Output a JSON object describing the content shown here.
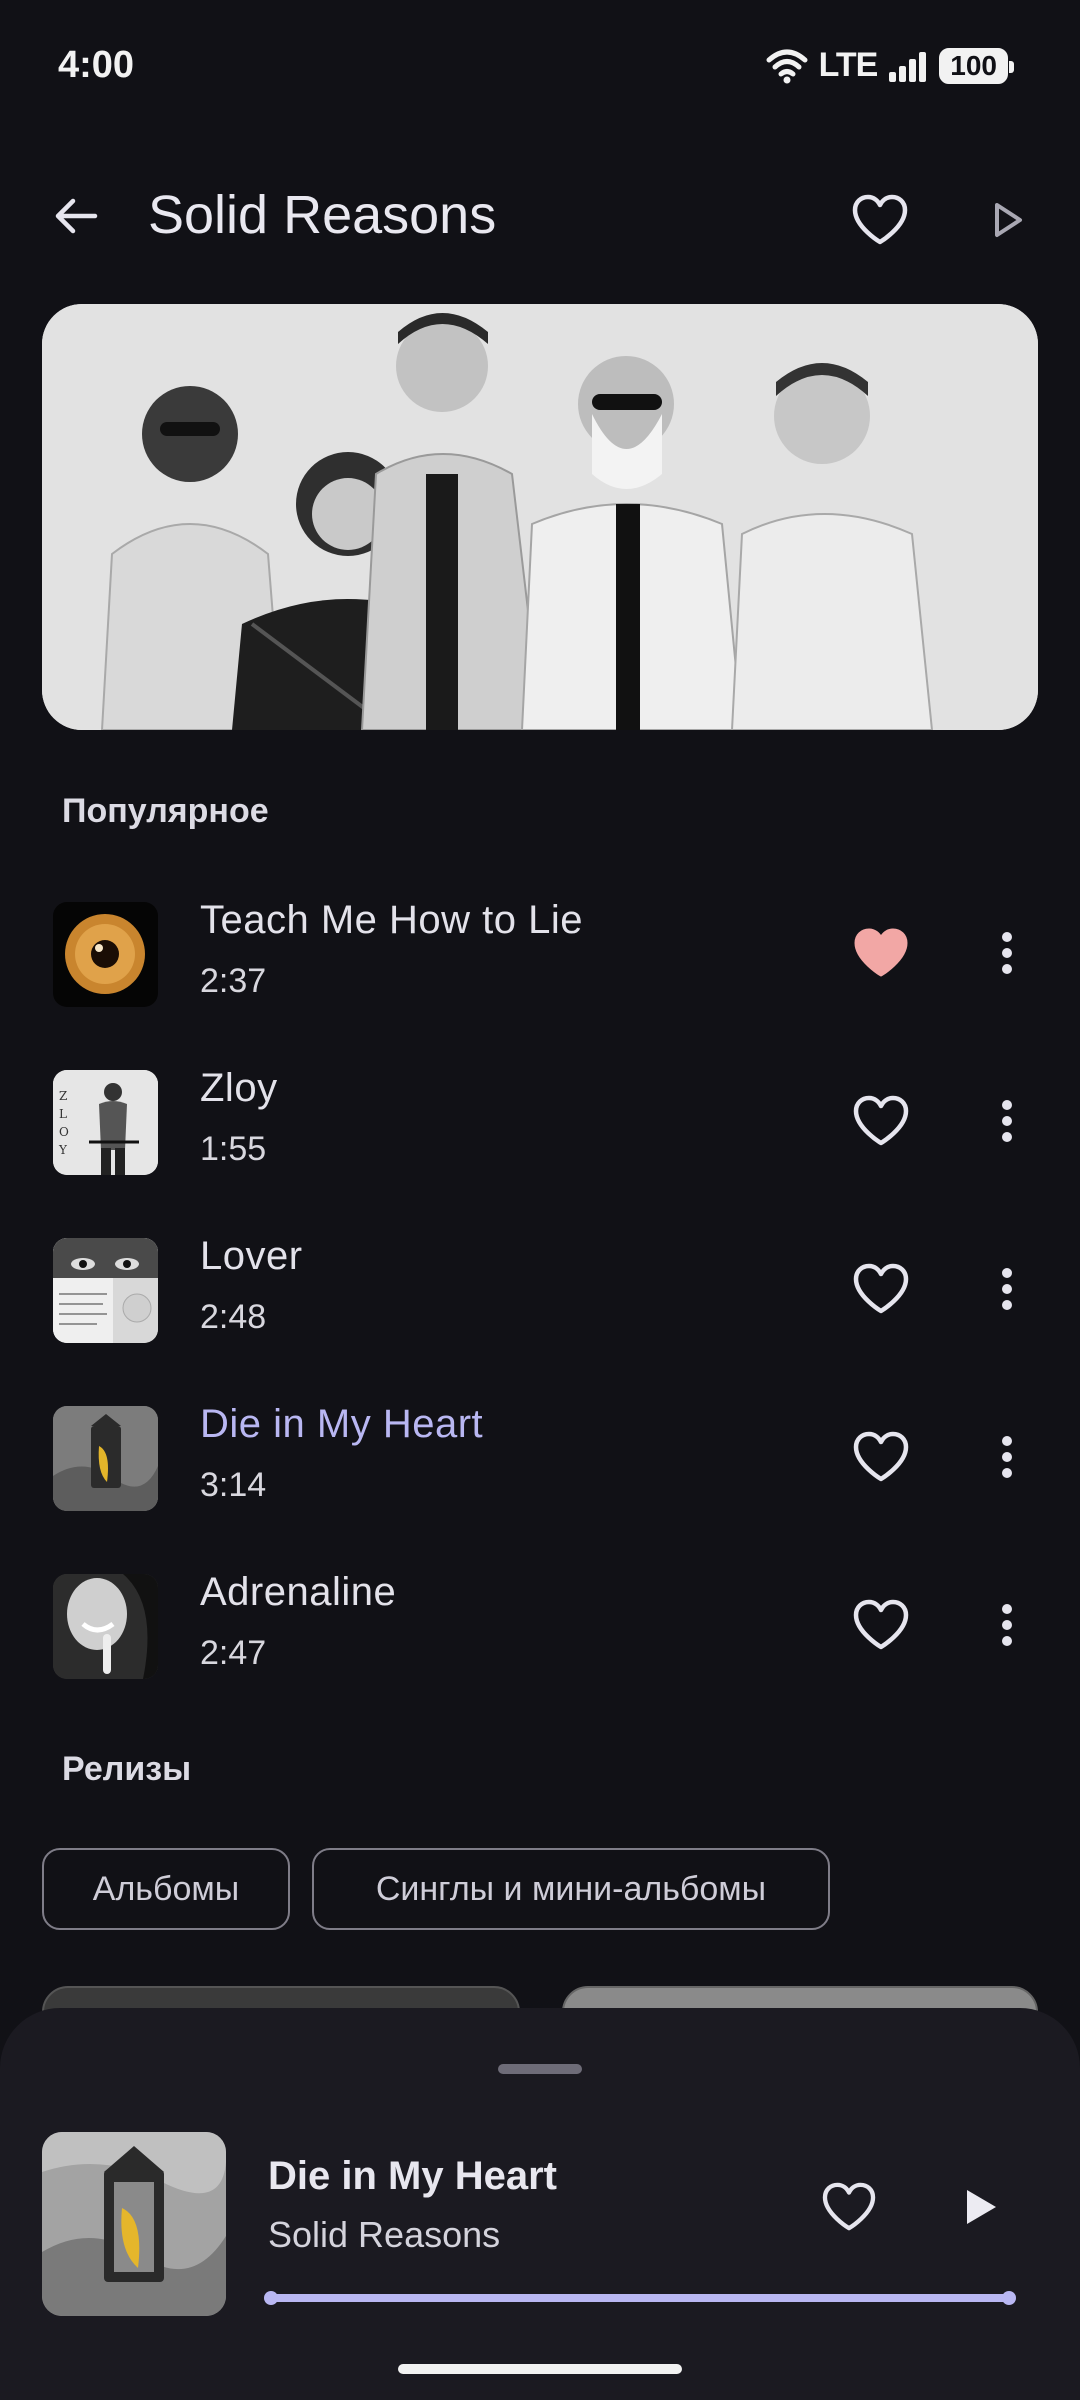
{
  "status_bar": {
    "time": "4:00",
    "network": "LTE",
    "battery": "100"
  },
  "header": {
    "title": "Solid Reasons"
  },
  "sections": {
    "popular": "Популярное",
    "releases": "Релизы"
  },
  "tracks": [
    {
      "title": "Teach Me How to Lie",
      "duration": "2:37",
      "liked": true
    },
    {
      "title": "Zloy",
      "duration": "1:55",
      "liked": false
    },
    {
      "title": "Lover",
      "duration": "2:48",
      "liked": false
    },
    {
      "title": "Die in My Heart",
      "duration": "3:14",
      "liked": false,
      "playing": true
    },
    {
      "title": "Adrenaline",
      "duration": "2:47",
      "liked": false
    }
  ],
  "release_filters": [
    "Альбомы",
    "Синглы и мини-альбомы"
  ],
  "now_playing": {
    "title": "Die in My Heart",
    "artist": "Solid Reasons",
    "progress": 0.99
  },
  "colors": {
    "background": "#111116",
    "accent": "#b9b7f2",
    "liked": "#f2a7a5",
    "sheet": "#1b1a21"
  }
}
